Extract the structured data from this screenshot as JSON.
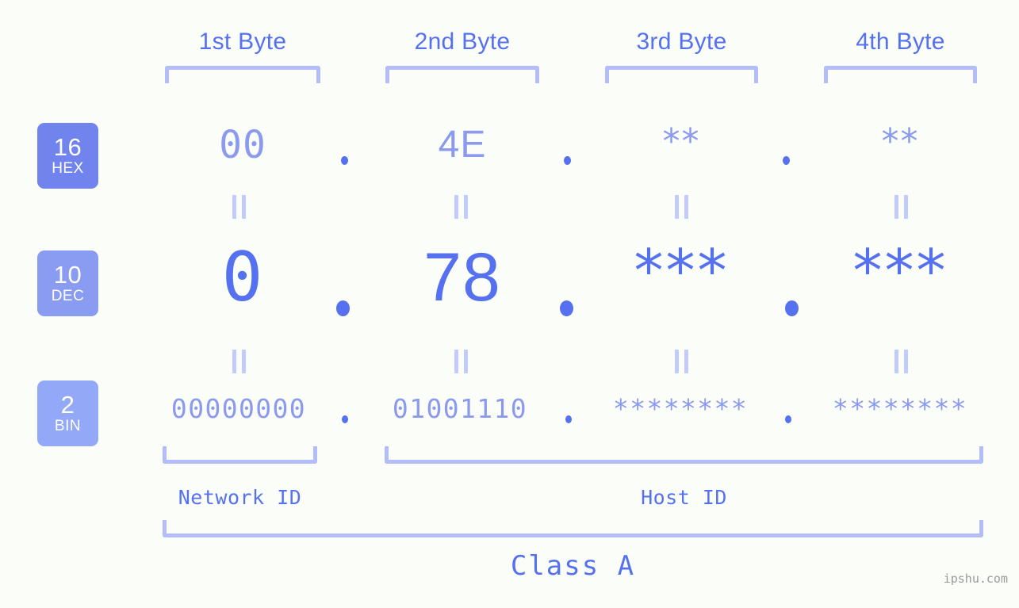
{
  "meta": {
    "background_color": "#fbfdf8",
    "accent_dark": "#5571f0",
    "accent_mid": "#8b9aee",
    "accent_light": "#b3bdfa",
    "watermark": "ipshu.com"
  },
  "headers": [
    {
      "label": "1st Byte"
    },
    {
      "label": "2nd Byte"
    },
    {
      "label": "3rd Byte"
    },
    {
      "label": "4th Byte"
    }
  ],
  "bases": [
    {
      "number": "16",
      "system": "HEX",
      "color": "#7184ee"
    },
    {
      "number": "10",
      "system": "DEC",
      "color": "#8a9bf2"
    },
    {
      "number": "2",
      "system": "BIN",
      "color": "#93a8f7"
    }
  ],
  "rows": {
    "hex": {
      "values": [
        "00",
        "4E",
        "**",
        "**"
      ],
      "separators": [
        ".",
        ".",
        "."
      ]
    },
    "dec": {
      "values": [
        "0",
        "78",
        "***",
        "***"
      ],
      "separators": [
        ".",
        ".",
        "."
      ]
    },
    "bin": {
      "values": [
        "00000000",
        "01001110",
        "********",
        "********"
      ],
      "separators": [
        ".",
        ".",
        "."
      ]
    }
  },
  "equals_marker": "=",
  "id_labels": {
    "network": "Network ID",
    "host": "Host ID"
  },
  "class_label": "Class A"
}
